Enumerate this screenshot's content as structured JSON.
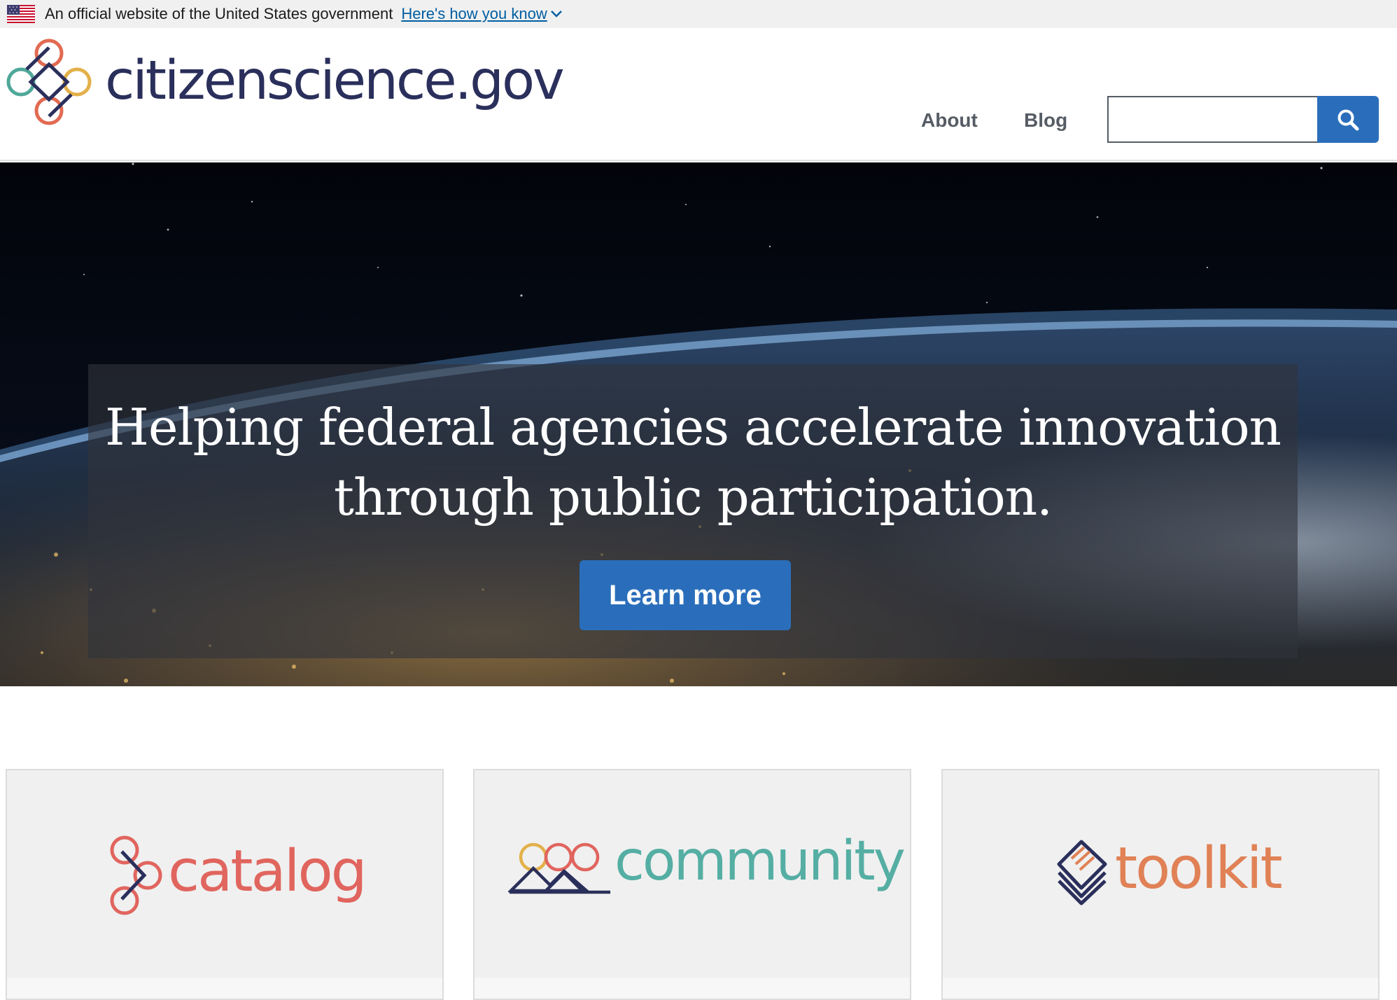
{
  "gov_banner": {
    "official_text": "An official website of the United States government",
    "how_link": "Here's how you know"
  },
  "header": {
    "site_name": "citizenscience.gov",
    "nav": {
      "about": "About",
      "blog": "Blog"
    },
    "search": {
      "value": "",
      "placeholder": ""
    }
  },
  "hero": {
    "title": "Helping federal agencies accelerate innovation through public participation.",
    "button": "Learn more"
  },
  "cards": [
    {
      "label": "catalog",
      "color": "#e0655e"
    },
    {
      "label": "community",
      "color": "#55aea3"
    },
    {
      "label": "toolkit",
      "color": "#e08156"
    }
  ],
  "colors": {
    "primary_button": "#2a6ebb",
    "brand_navy": "#2a2f5b",
    "gov_banner_bg": "#f0f0f0",
    "link": "#005ea2"
  },
  "icons": [
    "us-flag-icon",
    "chevron-down-icon",
    "search-icon",
    "citizenscience-logo-icon",
    "catalog-logo-icon",
    "community-logo-icon",
    "toolkit-logo-icon"
  ]
}
